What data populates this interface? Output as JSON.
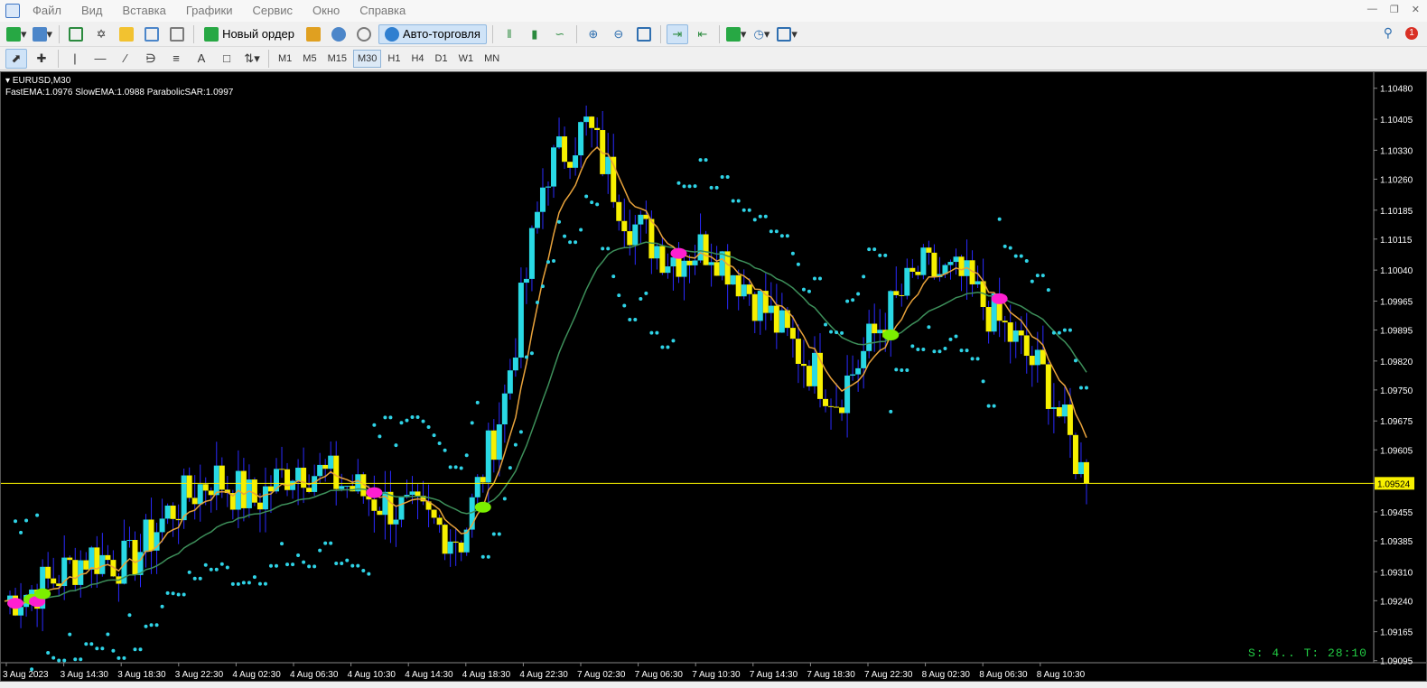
{
  "menu": [
    "Файл",
    "Вид",
    "Вставка",
    "Графики",
    "Сервис",
    "Окно",
    "Справка"
  ],
  "toolbar": {
    "new_order_label": "Новый ордер",
    "autotrading_label": "Авто-торговля",
    "notification_count": "1"
  },
  "timeframes": [
    "M1",
    "M5",
    "M15",
    "M30",
    "H1",
    "H4",
    "D1",
    "W1",
    "MN"
  ],
  "active_timeframe": "M30",
  "chart": {
    "symbol_label": "EURUSD,M30",
    "indicator_label": "FastEMA:1.0976  SlowEMA:1.0988  ParabolicSAR:1.0997",
    "current_price": "1.09524",
    "status_text": "S: 4..  T: 28:10",
    "colors": {
      "background": "#000000",
      "bull_candle": "#29d9e4",
      "bear_candle": "#f7f000",
      "wick": "#2a2aff",
      "fast_ema": "#e8a23b",
      "slow_ema": "#3d8f5a",
      "sar": "#2fd3e6",
      "price_line": "#f7f000",
      "buy_marker": "#7cf000",
      "sell_marker": "#ff1fd0",
      "axis_text": "#ffffff"
    }
  },
  "chart_data": {
    "type": "candlestick",
    "symbol": "EURUSD",
    "timeframe": "M30",
    "ylim": [
      1.0909,
      1.1051
    ],
    "y_ticks": [
      "1.10480",
      "1.10405",
      "1.10330",
      "1.10260",
      "1.10185",
      "1.10115",
      "1.10040",
      "1.09965",
      "1.09895",
      "1.09820",
      "1.09750",
      "1.09675",
      "1.09605",
      "1.09524",
      "1.09455",
      "1.09385",
      "1.09310",
      "1.09240",
      "1.09165",
      "1.09095"
    ],
    "x_ticks": [
      "3 Aug 2023",
      "3 Aug 14:30",
      "3 Aug 18:30",
      "3 Aug 22:30",
      "4 Aug 02:30",
      "4 Aug 06:30",
      "4 Aug 10:30",
      "4 Aug 14:30",
      "4 Aug 18:30",
      "4 Aug 22:30",
      "7 Aug 02:30",
      "7 Aug 06:30",
      "7 Aug 10:30",
      "7 Aug 14:30",
      "7 Aug 18:30",
      "7 Aug 22:30",
      "8 Aug 02:30",
      "8 Aug 06:30",
      "8 Aug 10:30"
    ],
    "close_path": [
      1.0924,
      1.0928,
      1.0935,
      1.0933,
      1.0946,
      1.0954,
      1.0948,
      1.0957,
      1.0953,
      1.0948,
      1.0944,
      1.0939,
      1.0972,
      1.1028,
      1.1039,
      1.1016,
      1.1007,
      1.101,
      1.0998,
      1.0985,
      1.0973,
      1.099,
      1.1004,
      1.1002,
      1.099,
      1.0978,
      1.0952
    ],
    "fast_ema_last": 1.0976,
    "slow_ema_last": 1.0988,
    "parabolic_sar_last": 1.0997
  }
}
